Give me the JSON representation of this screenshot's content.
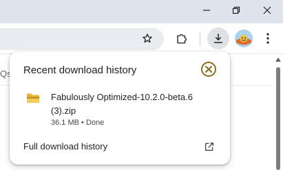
{
  "window": {
    "minimize_icon": "minimize-icon",
    "maximize_icon": "restore-icon",
    "close_icon": "close-icon"
  },
  "toolbar": {
    "bookmark_icon": "star-icon",
    "extensions_icon": "puzzle-piece-icon",
    "downloads_icon": "download-icon",
    "profile_icon": "avatar",
    "menu_icon": "three-dot-menu-icon"
  },
  "page": {
    "fragment_text": "Qs"
  },
  "download_bubble": {
    "title": "Recent download history",
    "close_icon": "close-circle-icon",
    "item": {
      "file_icon": "folder-icon",
      "file_name": "Fabulously Optimized-10.2.0-beta.6 (3).zip",
      "size": "36.1 MB",
      "separator": "•",
      "status": "Done"
    },
    "full_history_link": "Full download history",
    "open_external_icon": "open-in-new-icon"
  },
  "colors": {
    "titlebar": "#dfe3eb",
    "omnibox": "#e9edf2",
    "download_button_active": "#dfe3e8",
    "text_primary": "#1f1f1f",
    "text_secondary": "#474747",
    "folder_yellow": "#e8b83a",
    "close_icon_gold": "#8a6d1f"
  }
}
